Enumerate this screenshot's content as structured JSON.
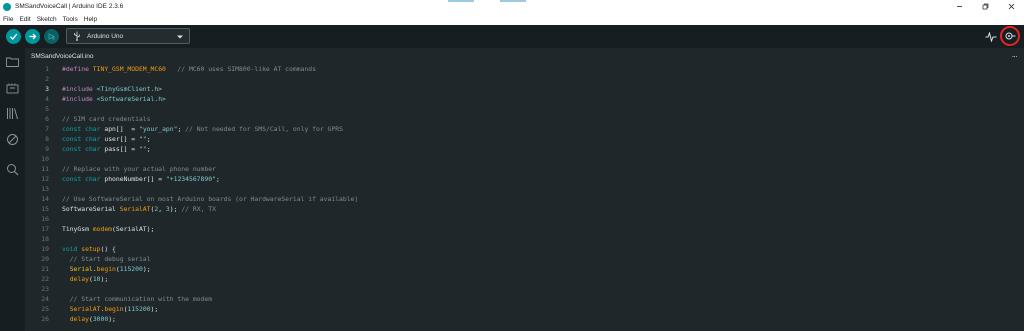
{
  "window": {
    "title": "SMSandVoiceCall | Arduino IDE 2.3.6"
  },
  "menu": [
    "File",
    "Edit",
    "Sketch",
    "Tools",
    "Help"
  ],
  "toolbar": {
    "board": "Arduino Uno"
  },
  "tabs": [
    {
      "label": "SMSandVoiceCall.ino"
    }
  ],
  "tab_more": "...",
  "colors": {
    "accent": "#00979c",
    "highlight": "#e02424",
    "background": "#1f272a"
  },
  "editor": {
    "lines": [
      {
        "n": "1",
        "tokens": [
          {
            "t": "#define ",
            "c": "c-pre"
          },
          {
            "t": "TINY_GSM_MODEM_MC60",
            "c": "c-fn"
          },
          {
            "t": "   // MC60 uses SIM800-like AT commands",
            "c": "c-com"
          }
        ]
      },
      {
        "n": "2",
        "tokens": []
      },
      {
        "n": "3",
        "tokens": [
          {
            "t": "#include ",
            "c": "c-pre"
          },
          {
            "t": "<TinyGsmClient.h>",
            "c": "c-str"
          }
        ]
      },
      {
        "n": "4",
        "tokens": [
          {
            "t": "#include ",
            "c": "c-pre"
          },
          {
            "t": "<SoftwareSerial.h>",
            "c": "c-str"
          }
        ]
      },
      {
        "n": "5",
        "tokens": []
      },
      {
        "n": "6",
        "tokens": [
          {
            "t": "// SIM card credentials",
            "c": "c-com"
          }
        ]
      },
      {
        "n": "7",
        "tokens": [
          {
            "t": "const ",
            "c": "c-kw"
          },
          {
            "t": "char ",
            "c": "c-kw"
          },
          {
            "t": "apn[]  = ",
            "c": ""
          },
          {
            "t": "\"your_apn\"",
            "c": "c-str"
          },
          {
            "t": "; ",
            "c": ""
          },
          {
            "t": "// Not needed for SMS/Call, only for GPRS",
            "c": "c-com"
          }
        ]
      },
      {
        "n": "8",
        "tokens": [
          {
            "t": "const ",
            "c": "c-kw"
          },
          {
            "t": "char ",
            "c": "c-kw"
          },
          {
            "t": "user[] = ",
            "c": ""
          },
          {
            "t": "\"\"",
            "c": "c-str"
          },
          {
            "t": ";",
            "c": ""
          }
        ]
      },
      {
        "n": "9",
        "tokens": [
          {
            "t": "const ",
            "c": "c-kw"
          },
          {
            "t": "char ",
            "c": "c-kw"
          },
          {
            "t": "pass[] = ",
            "c": ""
          },
          {
            "t": "\"\"",
            "c": "c-str"
          },
          {
            "t": ";",
            "c": ""
          }
        ]
      },
      {
        "n": "10",
        "tokens": []
      },
      {
        "n": "11",
        "tokens": [
          {
            "t": "// Replace with your actual phone number",
            "c": "c-com"
          }
        ]
      },
      {
        "n": "12",
        "tokens": [
          {
            "t": "const ",
            "c": "c-kw"
          },
          {
            "t": "char ",
            "c": "c-kw"
          },
          {
            "t": "phoneNumber[] = ",
            "c": ""
          },
          {
            "t": "\"+1234567890\"",
            "c": "c-str"
          },
          {
            "t": ";",
            "c": ""
          }
        ]
      },
      {
        "n": "13",
        "tokens": []
      },
      {
        "n": "14",
        "tokens": [
          {
            "t": "// Use SoftwareSerial on most Arduino boards (or HardwareSerial if available)",
            "c": "c-com"
          }
        ]
      },
      {
        "n": "15",
        "tokens": [
          {
            "t": "SoftwareSerial ",
            "c": ""
          },
          {
            "t": "SerialAT",
            "c": "c-fn"
          },
          {
            "t": "(",
            "c": ""
          },
          {
            "t": "2",
            "c": "c-num"
          },
          {
            "t": ", ",
            "c": ""
          },
          {
            "t": "3",
            "c": "c-num"
          },
          {
            "t": "); ",
            "c": ""
          },
          {
            "t": "// RX, TX",
            "c": "c-com"
          }
        ]
      },
      {
        "n": "16",
        "tokens": []
      },
      {
        "n": "17",
        "tokens": [
          {
            "t": "TinyGsm ",
            "c": ""
          },
          {
            "t": "modem",
            "c": "c-fn"
          },
          {
            "t": "(SerialAT);",
            "c": ""
          }
        ]
      },
      {
        "n": "18",
        "tokens": []
      },
      {
        "n": "19",
        "tokens": [
          {
            "t": "void ",
            "c": "c-kw"
          },
          {
            "t": "setup",
            "c": "c-fn"
          },
          {
            "t": "() {",
            "c": ""
          }
        ]
      },
      {
        "n": "20",
        "tokens": [
          {
            "t": "  // Start debug serial",
            "c": "c-com"
          }
        ]
      },
      {
        "n": "21",
        "tokens": [
          {
            "t": "  ",
            "c": ""
          },
          {
            "t": "Serial",
            "c": "c-cls"
          },
          {
            "t": ".",
            "c": ""
          },
          {
            "t": "begin",
            "c": "c-fn"
          },
          {
            "t": "(",
            "c": ""
          },
          {
            "t": "115200",
            "c": "c-num"
          },
          {
            "t": ");",
            "c": ""
          }
        ]
      },
      {
        "n": "22",
        "tokens": [
          {
            "t": "  ",
            "c": ""
          },
          {
            "t": "delay",
            "c": "c-fn"
          },
          {
            "t": "(",
            "c": ""
          },
          {
            "t": "10",
            "c": "c-num"
          },
          {
            "t": ");",
            "c": ""
          }
        ]
      },
      {
        "n": "23",
        "tokens": []
      },
      {
        "n": "24",
        "tokens": [
          {
            "t": "  // Start communication with the modem",
            "c": "c-com"
          }
        ]
      },
      {
        "n": "25",
        "tokens": [
          {
            "t": "  ",
            "c": ""
          },
          {
            "t": "SerialAT",
            "c": "c-fn"
          },
          {
            "t": ".",
            "c": ""
          },
          {
            "t": "begin",
            "c": "c-fn"
          },
          {
            "t": "(",
            "c": ""
          },
          {
            "t": "115200",
            "c": "c-num"
          },
          {
            "t": ");",
            "c": ""
          }
        ]
      },
      {
        "n": "26",
        "tokens": [
          {
            "t": "  ",
            "c": ""
          },
          {
            "t": "delay",
            "c": "c-fn"
          },
          {
            "t": "(",
            "c": ""
          },
          {
            "t": "3000",
            "c": "c-num"
          },
          {
            "t": ");",
            "c": ""
          }
        ]
      }
    ]
  }
}
